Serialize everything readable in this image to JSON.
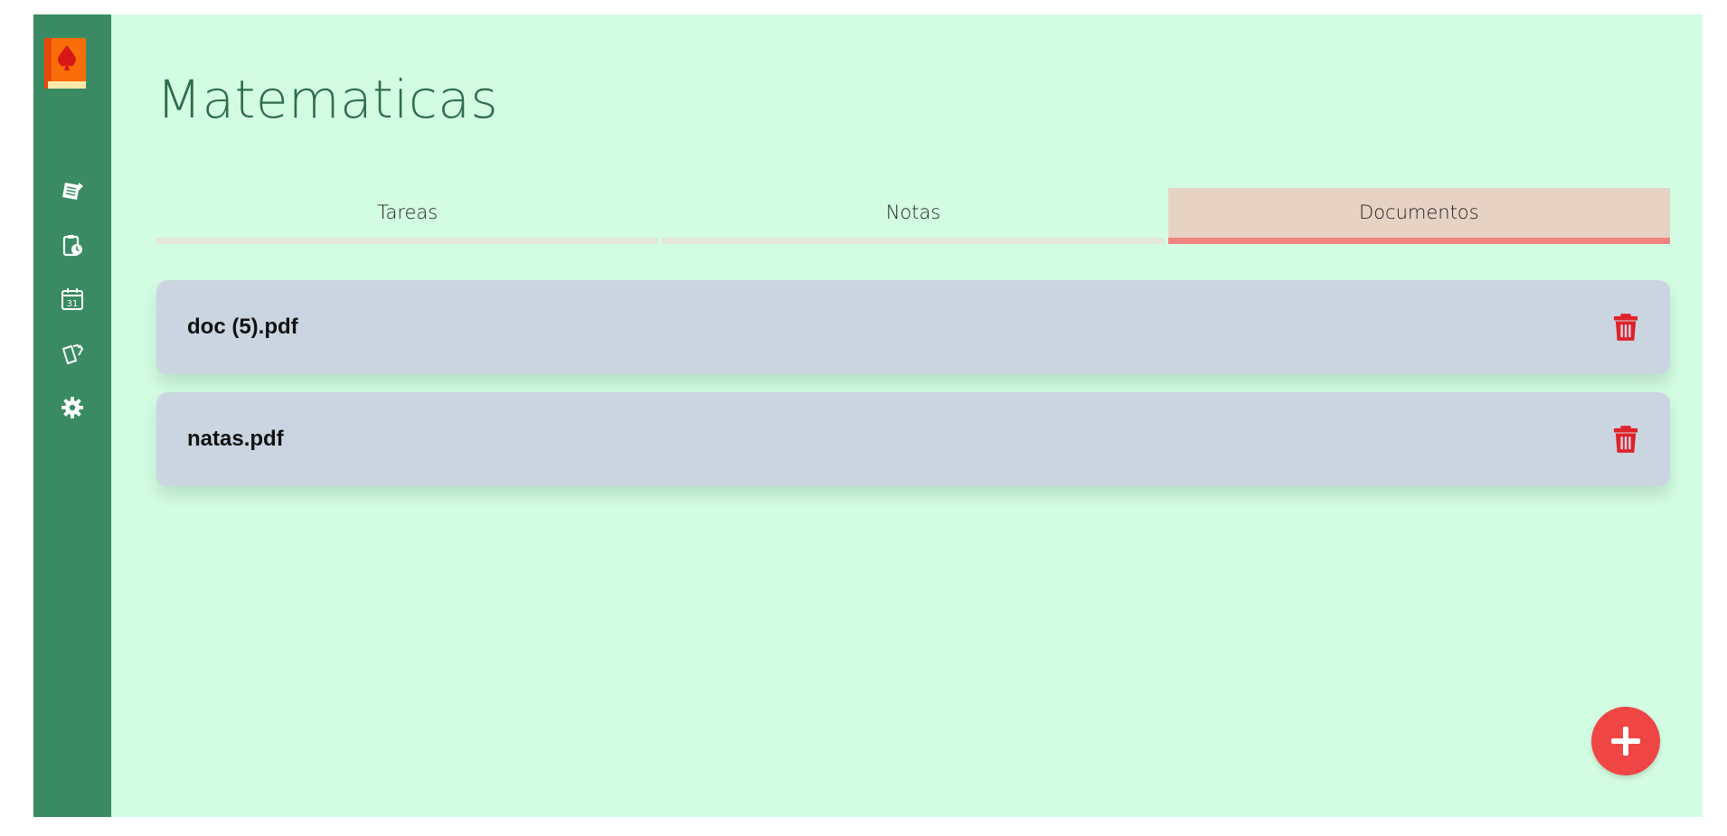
{
  "page": {
    "title": "Matematicas"
  },
  "sidebar": {
    "logo": "book-spade-logo",
    "items": [
      {
        "icon": "notes-icon"
      },
      {
        "icon": "clipboard-clock-icon"
      },
      {
        "icon": "calendar-icon",
        "label": "31"
      },
      {
        "icon": "cards-icon"
      },
      {
        "icon": "gear-icon"
      }
    ]
  },
  "tabs": [
    {
      "label": "Tareas",
      "active": false
    },
    {
      "label": "Notas",
      "active": false
    },
    {
      "label": "Documentos",
      "active": true
    }
  ],
  "documents": [
    {
      "name": "doc (5).pdf"
    },
    {
      "name": "natas.pdf"
    }
  ],
  "colors": {
    "sidebar": "#3a8b63",
    "background": "#d3fde3",
    "accent": "#f04545",
    "row": "#cbd5e1",
    "title": "#2f6e48"
  },
  "fab": {
    "icon": "plus-icon"
  }
}
